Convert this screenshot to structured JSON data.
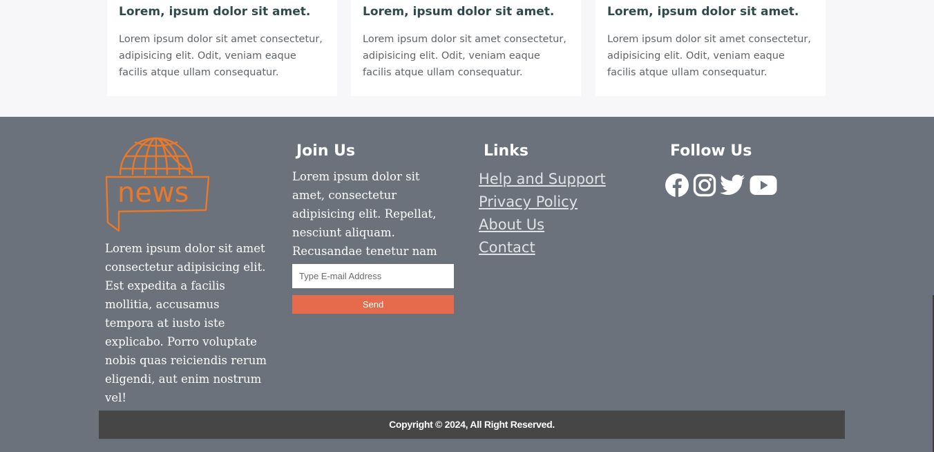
{
  "cards": [
    {
      "title": "Lorem, ipsum dolor sit amet.",
      "text": "Lorem ipsum dolor sit amet consectetur, adipisicing elit. Odit, veniam eaque facilis atque ullam consequatur."
    },
    {
      "title": "Lorem, ipsum dolor sit amet.",
      "text": "Lorem ipsum dolor sit amet consectetur, adipisicing elit. Odit, veniam eaque facilis atque ullam consequatur."
    },
    {
      "title": "Lorem, ipsum dolor sit amet.",
      "text": "Lorem ipsum dolor sit amet consectetur, adipisicing elit. Odit, veniam eaque facilis atque ullam consequatur."
    }
  ],
  "footer": {
    "logo": {
      "text": "news",
      "icon": "globe-speech-bubble-icon",
      "color": "#e8782a"
    },
    "about_text": "Lorem ipsum dolor sit amet consectetur adipisicing elit. Est expedita a facilis mollitia, accusamus tempora at iusto iste explicabo. Porro voluptate nobis quas reiciendis rerum eligendi, aut enim nostrum vel!",
    "join": {
      "heading": "Join Us",
      "text": "Lorem ipsum dolor sit amet, consectetur adipisicing elit. Repellat, nesciunt aliquam. Recusandae tenetur nam debitis aspers",
      "email_placeholder": "Type E-mail Address",
      "email_value": "",
      "send_label": "Send"
    },
    "links": {
      "heading": "Links",
      "items": [
        "Help and Support",
        "Privacy Policy",
        "About Us",
        "Contact"
      ]
    },
    "follow": {
      "heading": "Follow Us",
      "icons": [
        "facebook-icon",
        "instagram-icon",
        "twitter-icon",
        "youtube-icon"
      ]
    },
    "copyright": "Copyright © 2024, All Right Reserved."
  },
  "colors": {
    "footer_bg": "#6b727b",
    "accent": "#e56b4c",
    "copyright_bg": "#464646",
    "card_bg": "#ffffff",
    "page_bg": "#f7f7f9"
  }
}
